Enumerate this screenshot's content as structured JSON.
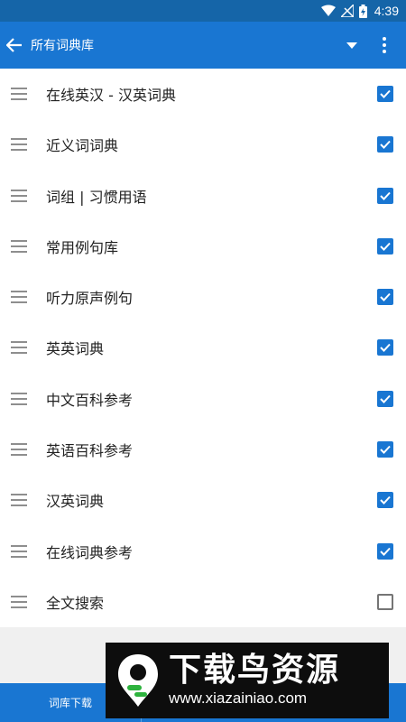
{
  "status_bar": {
    "time": "4:39",
    "icons": [
      "wifi-icon",
      "no-signal-icon",
      "battery-charging-icon"
    ]
  },
  "app_bar": {
    "title": "所有词典库",
    "back_icon": "arrow-left-icon",
    "dropdown_icon": "triangle-down-icon",
    "more_icon": "more-vert-icon"
  },
  "dictionaries": [
    {
      "label": "在线英汉 - 汉英词典",
      "checked": true
    },
    {
      "label": "近义词词典",
      "checked": true
    },
    {
      "label": "词组 | 习惯用语",
      "checked": true
    },
    {
      "label": "常用例句库",
      "checked": true
    },
    {
      "label": "听力原声例句",
      "checked": true
    },
    {
      "label": "英英词典",
      "checked": true
    },
    {
      "label": "中文百科参考",
      "checked": true
    },
    {
      "label": "英语百科参考",
      "checked": true
    },
    {
      "label": "汉英词典",
      "checked": true
    },
    {
      "label": "在线词典参考",
      "checked": true
    },
    {
      "label": "全文搜索",
      "checked": false
    }
  ],
  "bottom_bar": {
    "download_label": "词库下载"
  },
  "watermark": {
    "title": "下载鸟资源",
    "url": "www.xiazainiao.com"
  },
  "colors": {
    "status_bar": "#1565a8",
    "app_bar": "#1976d2",
    "checkbox": "#1976d2"
  }
}
